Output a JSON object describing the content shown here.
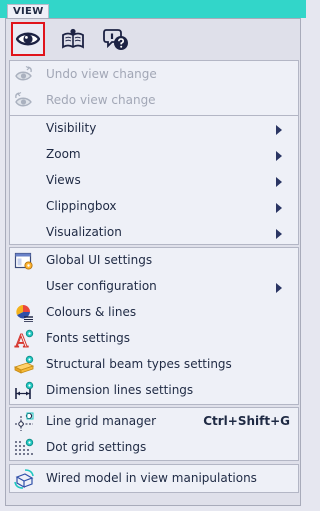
{
  "tab": {
    "label": "VIEW"
  },
  "toolbar": {
    "buttons": [
      {
        "icon": "eye-icon",
        "selected": true
      },
      {
        "icon": "book-icon",
        "selected": false
      },
      {
        "icon": "help-chat-icon",
        "selected": false
      }
    ]
  },
  "colors": {
    "accent_bar": "#32d6c9",
    "selection_border": "#e0141b",
    "text": "#1f2a44",
    "disabled_text": "#a2a7b6"
  },
  "groups": [
    {
      "items": [
        {
          "label": "Undo view change",
          "icon": "undo-view-icon",
          "enabled": false
        },
        {
          "label": "Redo view change",
          "icon": "redo-view-icon",
          "enabled": false
        }
      ]
    },
    {
      "items": [
        {
          "label": "Visibility",
          "submenu": true
        },
        {
          "label": "Zoom",
          "submenu": true
        },
        {
          "label": "Views",
          "submenu": true
        },
        {
          "label": "Clippingbox",
          "submenu": true
        },
        {
          "label": "Visualization",
          "submenu": true
        }
      ]
    },
    {
      "items": [
        {
          "label": "Global UI settings",
          "icon": "ui-settings-icon"
        },
        {
          "label": "User configuration",
          "submenu": true
        },
        {
          "label": "Colours & lines",
          "icon": "colours-lines-icon"
        },
        {
          "label": "Fonts settings",
          "icon": "fonts-icon"
        },
        {
          "label": "Structural beam types settings",
          "icon": "beam-types-icon"
        },
        {
          "label": "Dimension lines settings",
          "icon": "dimension-lines-icon"
        }
      ]
    },
    {
      "items": [
        {
          "label": "Line grid manager",
          "icon": "line-grid-icon",
          "shortcut": "Ctrl+Shift+G"
        },
        {
          "label": "Dot grid settings",
          "icon": "dot-grid-icon"
        }
      ]
    },
    {
      "items": [
        {
          "label": "Wired model in view manipulations",
          "icon": "wired-model-icon"
        }
      ]
    }
  ]
}
